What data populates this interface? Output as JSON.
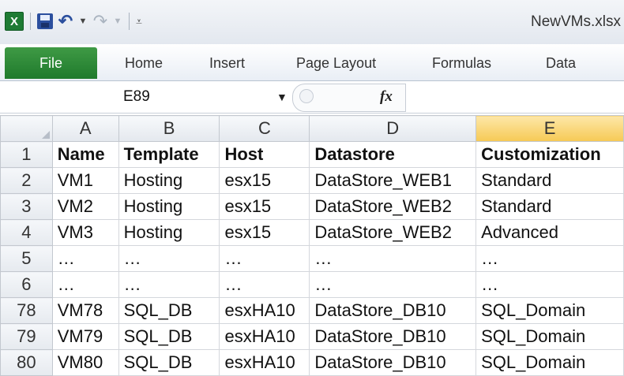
{
  "window": {
    "title": "NewVMs.xlsx"
  },
  "qat": {
    "logo": "X"
  },
  "ribbon": {
    "tabs": [
      "File",
      "Home",
      "Insert",
      "Page Layout",
      "Formulas",
      "Data"
    ]
  },
  "formula_bar": {
    "name_box": "E89",
    "fx": "fx",
    "formula": ""
  },
  "grid": {
    "columns": [
      "A",
      "B",
      "C",
      "D",
      "E"
    ],
    "selected_column": "E",
    "rows": [
      {
        "num": "1",
        "cells": [
          "Name",
          "Template",
          "Host",
          "Datastore",
          "Customization"
        ]
      },
      {
        "num": "2",
        "cells": [
          "VM1",
          "Hosting",
          "esx15",
          "DataStore_WEB1",
          "Standard"
        ]
      },
      {
        "num": "3",
        "cells": [
          "VM2",
          "Hosting",
          "esx15",
          "DataStore_WEB2",
          "Standard"
        ]
      },
      {
        "num": "4",
        "cells": [
          "VM3",
          "Hosting",
          "esx15",
          "DataStore_WEB2",
          "Advanced"
        ]
      },
      {
        "num": "5",
        "cells": [
          "…",
          "…",
          "…",
          "…",
          "…"
        ]
      },
      {
        "num": "6",
        "cells": [
          "…",
          "…",
          "…",
          "…",
          "…"
        ]
      },
      {
        "num": "78",
        "cells": [
          "VM78",
          "SQL_DB",
          "esxHA10",
          "DataStore_DB10",
          "SQL_Domain"
        ]
      },
      {
        "num": "79",
        "cells": [
          "VM79",
          "SQL_DB",
          "esxHA10",
          "DataStore_DB10",
          "SQL_Domain"
        ]
      },
      {
        "num": "80",
        "cells": [
          "VM80",
          "SQL_DB",
          "esxHA10",
          "DataStore_DB10",
          "SQL_Domain"
        ]
      }
    ]
  },
  "colors": {
    "file_tab": "#1f7a2c",
    "selected_header": "#f6c955",
    "excel_green": "#1e7b34"
  }
}
